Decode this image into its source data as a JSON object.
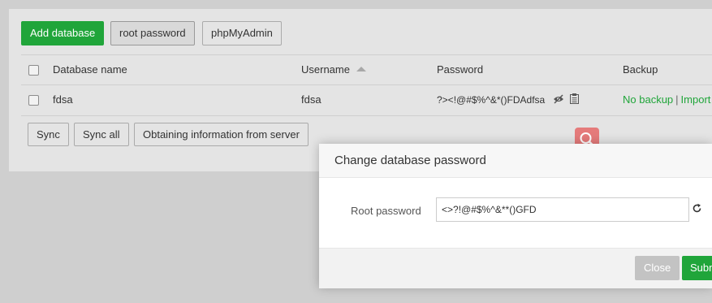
{
  "toolbar": {
    "add_database": "Add database",
    "root_password": "root password",
    "phpmyadmin": "phpMyAdmin"
  },
  "table": {
    "columns": {
      "name": "Database name",
      "username": "Username",
      "password": "Password",
      "backup": "Backup"
    },
    "rows": [
      {
        "name": "fdsa",
        "username": "fdsa",
        "password": "?><!@#$%^&*()FDAdfsa",
        "backup_status": "No backup",
        "backup_separator": "|",
        "backup_action": "Import"
      }
    ]
  },
  "actions": {
    "sync": "Sync",
    "sync_all": "Sync all",
    "obtain": "Obtaining information from server"
  },
  "modal": {
    "title": "Change database password",
    "label": "Root password",
    "value": "<>?!@#$%^&**()GFD",
    "close": "Close",
    "submit": "Submit"
  },
  "colors": {
    "accent": "#20a53a",
    "search_badge": "#e57b7b"
  },
  "icons": [
    "eye-icon",
    "copy-icon",
    "search-icon",
    "refresh-icon"
  ]
}
